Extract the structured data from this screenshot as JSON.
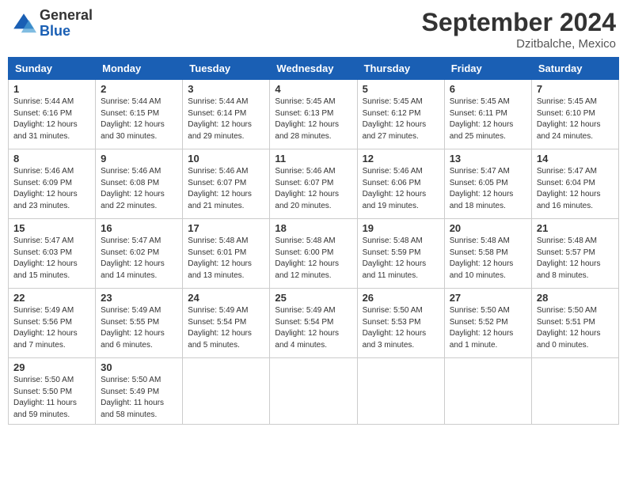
{
  "header": {
    "logo": {
      "line1": "General",
      "line2": "Blue"
    },
    "month": "September 2024",
    "location": "Dzitbalche, Mexico"
  },
  "weekdays": [
    "Sunday",
    "Monday",
    "Tuesday",
    "Wednesday",
    "Thursday",
    "Friday",
    "Saturday"
  ],
  "weeks": [
    [
      {
        "day": "1",
        "sunrise": "Sunrise: 5:44 AM",
        "sunset": "Sunset: 6:16 PM",
        "daylight": "Daylight: 12 hours and 31 minutes."
      },
      {
        "day": "2",
        "sunrise": "Sunrise: 5:44 AM",
        "sunset": "Sunset: 6:15 PM",
        "daylight": "Daylight: 12 hours and 30 minutes."
      },
      {
        "day": "3",
        "sunrise": "Sunrise: 5:44 AM",
        "sunset": "Sunset: 6:14 PM",
        "daylight": "Daylight: 12 hours and 29 minutes."
      },
      {
        "day": "4",
        "sunrise": "Sunrise: 5:45 AM",
        "sunset": "Sunset: 6:13 PM",
        "daylight": "Daylight: 12 hours and 28 minutes."
      },
      {
        "day": "5",
        "sunrise": "Sunrise: 5:45 AM",
        "sunset": "Sunset: 6:12 PM",
        "daylight": "Daylight: 12 hours and 27 minutes."
      },
      {
        "day": "6",
        "sunrise": "Sunrise: 5:45 AM",
        "sunset": "Sunset: 6:11 PM",
        "daylight": "Daylight: 12 hours and 25 minutes."
      },
      {
        "day": "7",
        "sunrise": "Sunrise: 5:45 AM",
        "sunset": "Sunset: 6:10 PM",
        "daylight": "Daylight: 12 hours and 24 minutes."
      }
    ],
    [
      {
        "day": "8",
        "sunrise": "Sunrise: 5:46 AM",
        "sunset": "Sunset: 6:09 PM",
        "daylight": "Daylight: 12 hours and 23 minutes."
      },
      {
        "day": "9",
        "sunrise": "Sunrise: 5:46 AM",
        "sunset": "Sunset: 6:08 PM",
        "daylight": "Daylight: 12 hours and 22 minutes."
      },
      {
        "day": "10",
        "sunrise": "Sunrise: 5:46 AM",
        "sunset": "Sunset: 6:07 PM",
        "daylight": "Daylight: 12 hours and 21 minutes."
      },
      {
        "day": "11",
        "sunrise": "Sunrise: 5:46 AM",
        "sunset": "Sunset: 6:07 PM",
        "daylight": "Daylight: 12 hours and 20 minutes."
      },
      {
        "day": "12",
        "sunrise": "Sunrise: 5:46 AM",
        "sunset": "Sunset: 6:06 PM",
        "daylight": "Daylight: 12 hours and 19 minutes."
      },
      {
        "day": "13",
        "sunrise": "Sunrise: 5:47 AM",
        "sunset": "Sunset: 6:05 PM",
        "daylight": "Daylight: 12 hours and 18 minutes."
      },
      {
        "day": "14",
        "sunrise": "Sunrise: 5:47 AM",
        "sunset": "Sunset: 6:04 PM",
        "daylight": "Daylight: 12 hours and 16 minutes."
      }
    ],
    [
      {
        "day": "15",
        "sunrise": "Sunrise: 5:47 AM",
        "sunset": "Sunset: 6:03 PM",
        "daylight": "Daylight: 12 hours and 15 minutes."
      },
      {
        "day": "16",
        "sunrise": "Sunrise: 5:47 AM",
        "sunset": "Sunset: 6:02 PM",
        "daylight": "Daylight: 12 hours and 14 minutes."
      },
      {
        "day": "17",
        "sunrise": "Sunrise: 5:48 AM",
        "sunset": "Sunset: 6:01 PM",
        "daylight": "Daylight: 12 hours and 13 minutes."
      },
      {
        "day": "18",
        "sunrise": "Sunrise: 5:48 AM",
        "sunset": "Sunset: 6:00 PM",
        "daylight": "Daylight: 12 hours and 12 minutes."
      },
      {
        "day": "19",
        "sunrise": "Sunrise: 5:48 AM",
        "sunset": "Sunset: 5:59 PM",
        "daylight": "Daylight: 12 hours and 11 minutes."
      },
      {
        "day": "20",
        "sunrise": "Sunrise: 5:48 AM",
        "sunset": "Sunset: 5:58 PM",
        "daylight": "Daylight: 12 hours and 10 minutes."
      },
      {
        "day": "21",
        "sunrise": "Sunrise: 5:48 AM",
        "sunset": "Sunset: 5:57 PM",
        "daylight": "Daylight: 12 hours and 8 minutes."
      }
    ],
    [
      {
        "day": "22",
        "sunrise": "Sunrise: 5:49 AM",
        "sunset": "Sunset: 5:56 PM",
        "daylight": "Daylight: 12 hours and 7 minutes."
      },
      {
        "day": "23",
        "sunrise": "Sunrise: 5:49 AM",
        "sunset": "Sunset: 5:55 PM",
        "daylight": "Daylight: 12 hours and 6 minutes."
      },
      {
        "day": "24",
        "sunrise": "Sunrise: 5:49 AM",
        "sunset": "Sunset: 5:54 PM",
        "daylight": "Daylight: 12 hours and 5 minutes."
      },
      {
        "day": "25",
        "sunrise": "Sunrise: 5:49 AM",
        "sunset": "Sunset: 5:54 PM",
        "daylight": "Daylight: 12 hours and 4 minutes."
      },
      {
        "day": "26",
        "sunrise": "Sunrise: 5:50 AM",
        "sunset": "Sunset: 5:53 PM",
        "daylight": "Daylight: 12 hours and 3 minutes."
      },
      {
        "day": "27",
        "sunrise": "Sunrise: 5:50 AM",
        "sunset": "Sunset: 5:52 PM",
        "daylight": "Daylight: 12 hours and 1 minute."
      },
      {
        "day": "28",
        "sunrise": "Sunrise: 5:50 AM",
        "sunset": "Sunset: 5:51 PM",
        "daylight": "Daylight: 12 hours and 0 minutes."
      }
    ],
    [
      {
        "day": "29",
        "sunrise": "Sunrise: 5:50 AM",
        "sunset": "Sunset: 5:50 PM",
        "daylight": "Daylight: 11 hours and 59 minutes."
      },
      {
        "day": "30",
        "sunrise": "Sunrise: 5:50 AM",
        "sunset": "Sunset: 5:49 PM",
        "daylight": "Daylight: 11 hours and 58 minutes."
      },
      null,
      null,
      null,
      null,
      null
    ]
  ]
}
